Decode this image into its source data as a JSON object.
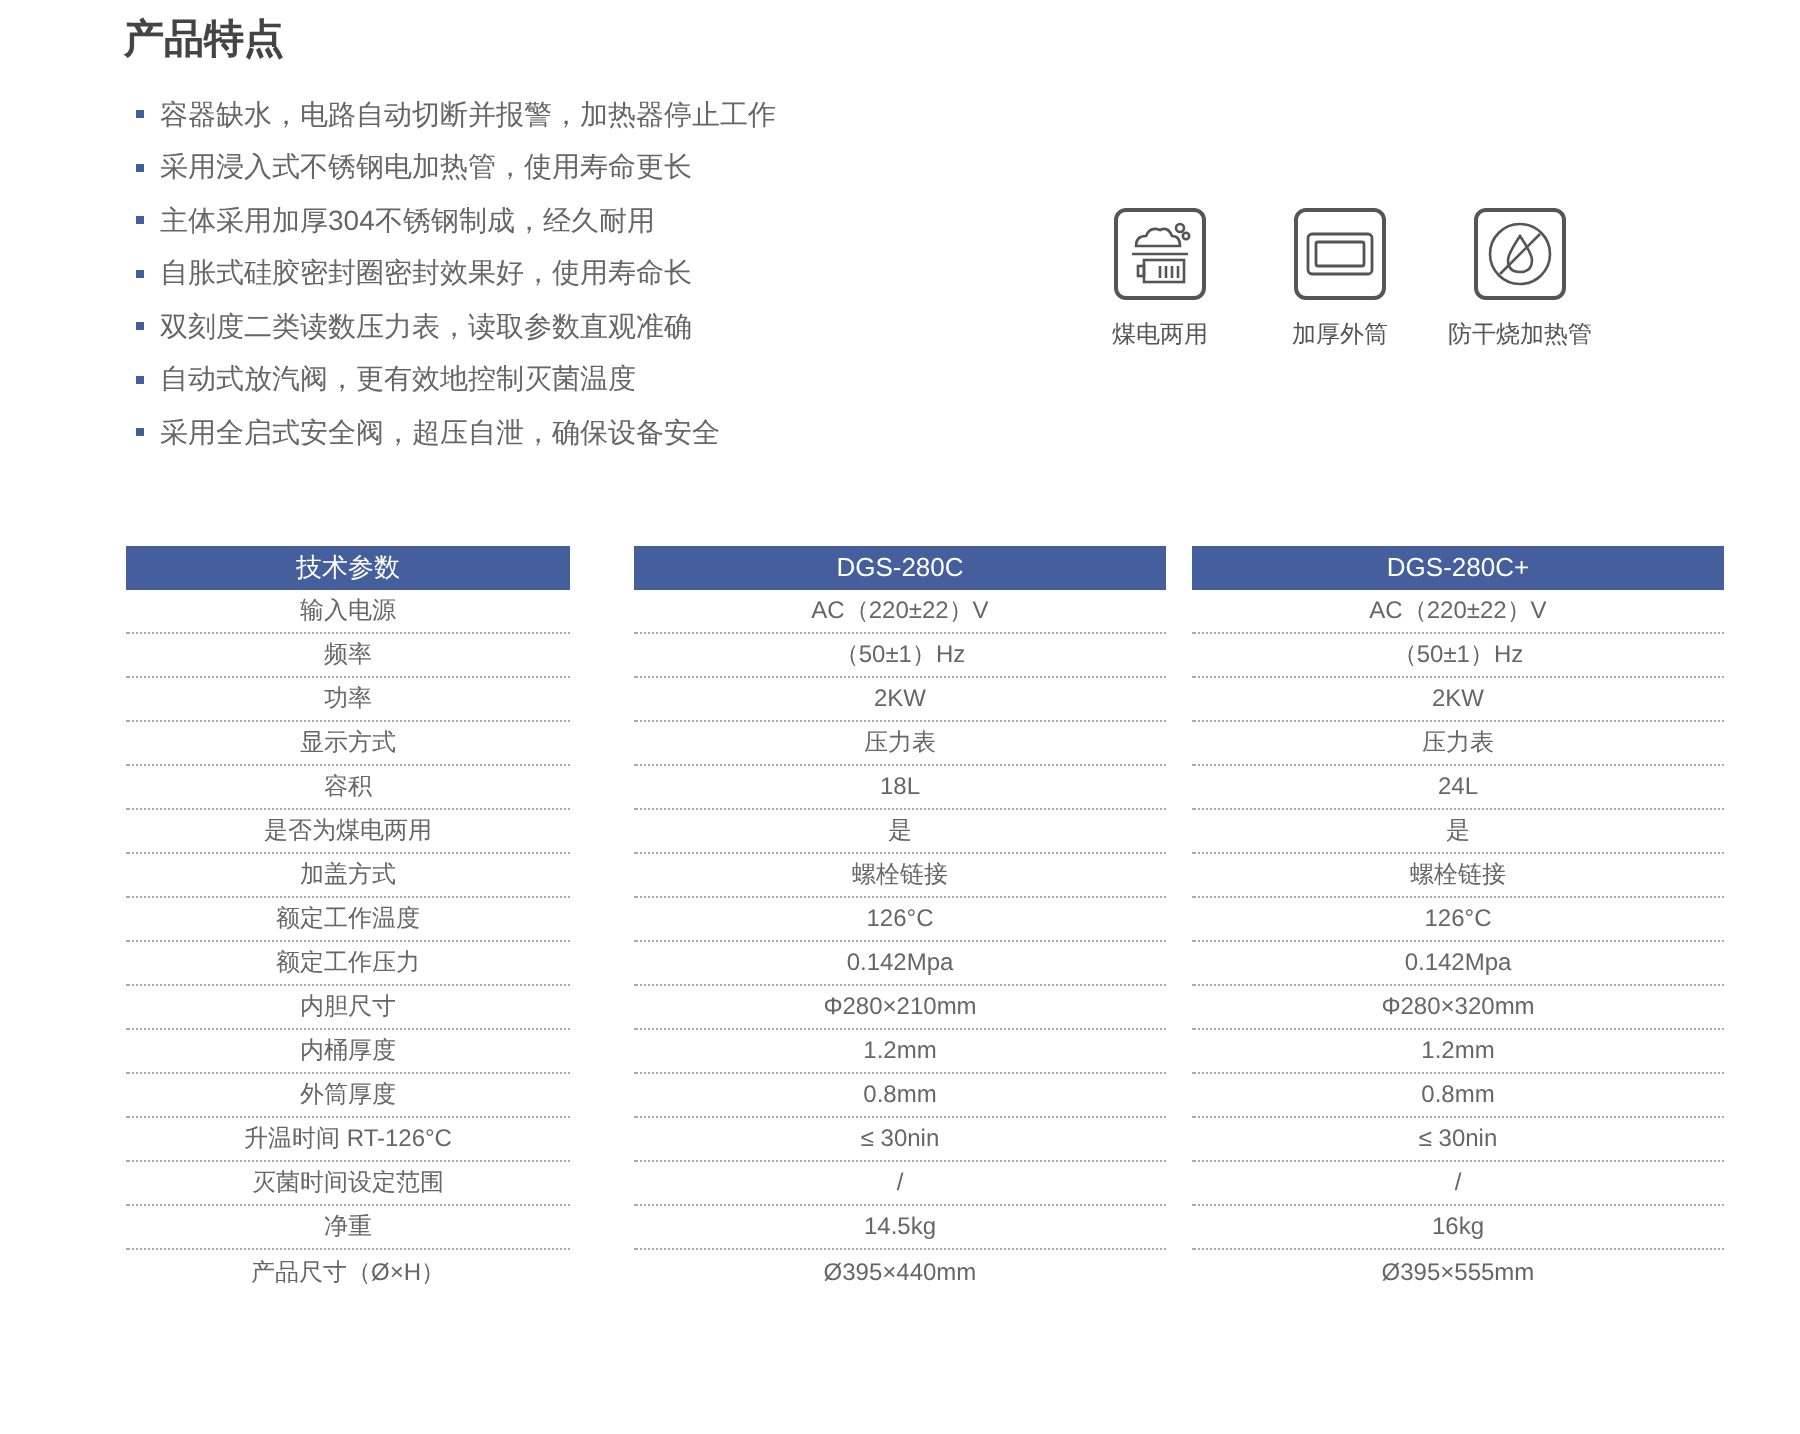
{
  "section_title": "产品特点",
  "features": [
    "容器缺水，电路自动切断并报警，加热器停止工作",
    "采用浸入式不锈钢电加热管，使用寿命更长",
    "主体采用加厚304不锈钢制成，经久耐用",
    "自胀式硅胶密封圈密封效果好，使用寿命长",
    "双刻度二类读数压力表，读取参数直观准确",
    "自动式放汽阀，更有效地控制灭菌温度",
    "采用全启式安全阀，超压自泄，确保设备安全"
  ],
  "highlights": [
    {
      "kind": "dual",
      "label": "煤电两用"
    },
    {
      "kind": "shell",
      "label": "加厚外筒"
    },
    {
      "kind": "dry",
      "label": "防干烧加热管"
    }
  ],
  "table": {
    "columns": [
      "技术参数",
      "DGS-280C",
      "DGS-280C+"
    ],
    "rows": [
      [
        "输入电源",
        "AC（220±22）V",
        "AC（220±22）V"
      ],
      [
        "频率",
        "（50±1）Hz",
        "（50±1）Hz"
      ],
      [
        "功率",
        "2KW",
        "2KW"
      ],
      [
        "显示方式",
        "压力表",
        "压力表"
      ],
      [
        "容积",
        "18L",
        "24L"
      ],
      [
        "是否为煤电两用",
        "是",
        "是"
      ],
      [
        "加盖方式",
        "螺栓链接",
        "螺栓链接"
      ],
      [
        "额定工作温度",
        "126°C",
        "126°C"
      ],
      [
        "额定工作压力",
        "0.142Mpa",
        "0.142Mpa"
      ],
      [
        "内胆尺寸",
        "Φ280×210mm",
        "Φ280×320mm"
      ],
      [
        "内桶厚度",
        "1.2mm",
        "1.2mm"
      ],
      [
        "外筒厚度",
        "0.8mm",
        "0.8mm"
      ],
      [
        "升温时间 RT-126°C",
        "≤ 30nin",
        "≤ 30nin"
      ],
      [
        "灭菌时间设定范围",
        "/",
        "/"
      ],
      [
        "净重",
        "14.5kg",
        "16kg"
      ],
      [
        "产品尺寸（Ø×H）",
        "Ø395×440mm",
        "Ø395×555mm"
      ]
    ]
  }
}
